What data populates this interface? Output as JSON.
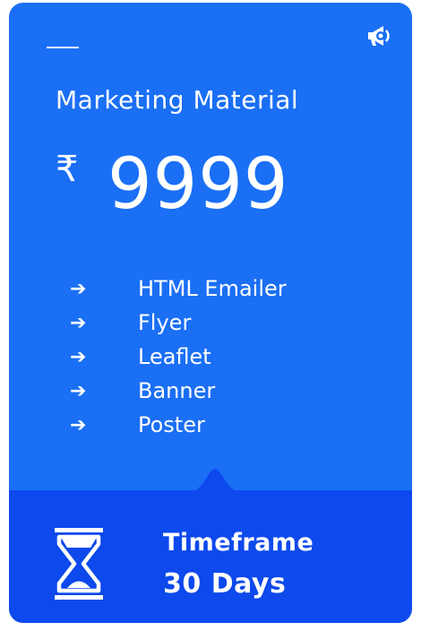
{
  "card": {
    "title": "Marketing Material",
    "currency": "₹",
    "price": "9999",
    "features": [
      {
        "arrow": "➔",
        "label": "HTML Emailer"
      },
      {
        "arrow": "➔",
        "label": "Flyer"
      },
      {
        "arrow": "➔",
        "label": "Leaflet"
      },
      {
        "arrow": "➔",
        "label": "Banner"
      },
      {
        "arrow": "➔",
        "label": "Poster"
      }
    ],
    "icons": {
      "top": "megaphone-icon",
      "bottom": "hourglass-icon"
    },
    "timeframe": {
      "label": "Timeframe",
      "value": "30 Days"
    }
  },
  "colors": {
    "card": "#1a6ff5",
    "footer": "#0d49ec",
    "text": "#ffffff"
  }
}
